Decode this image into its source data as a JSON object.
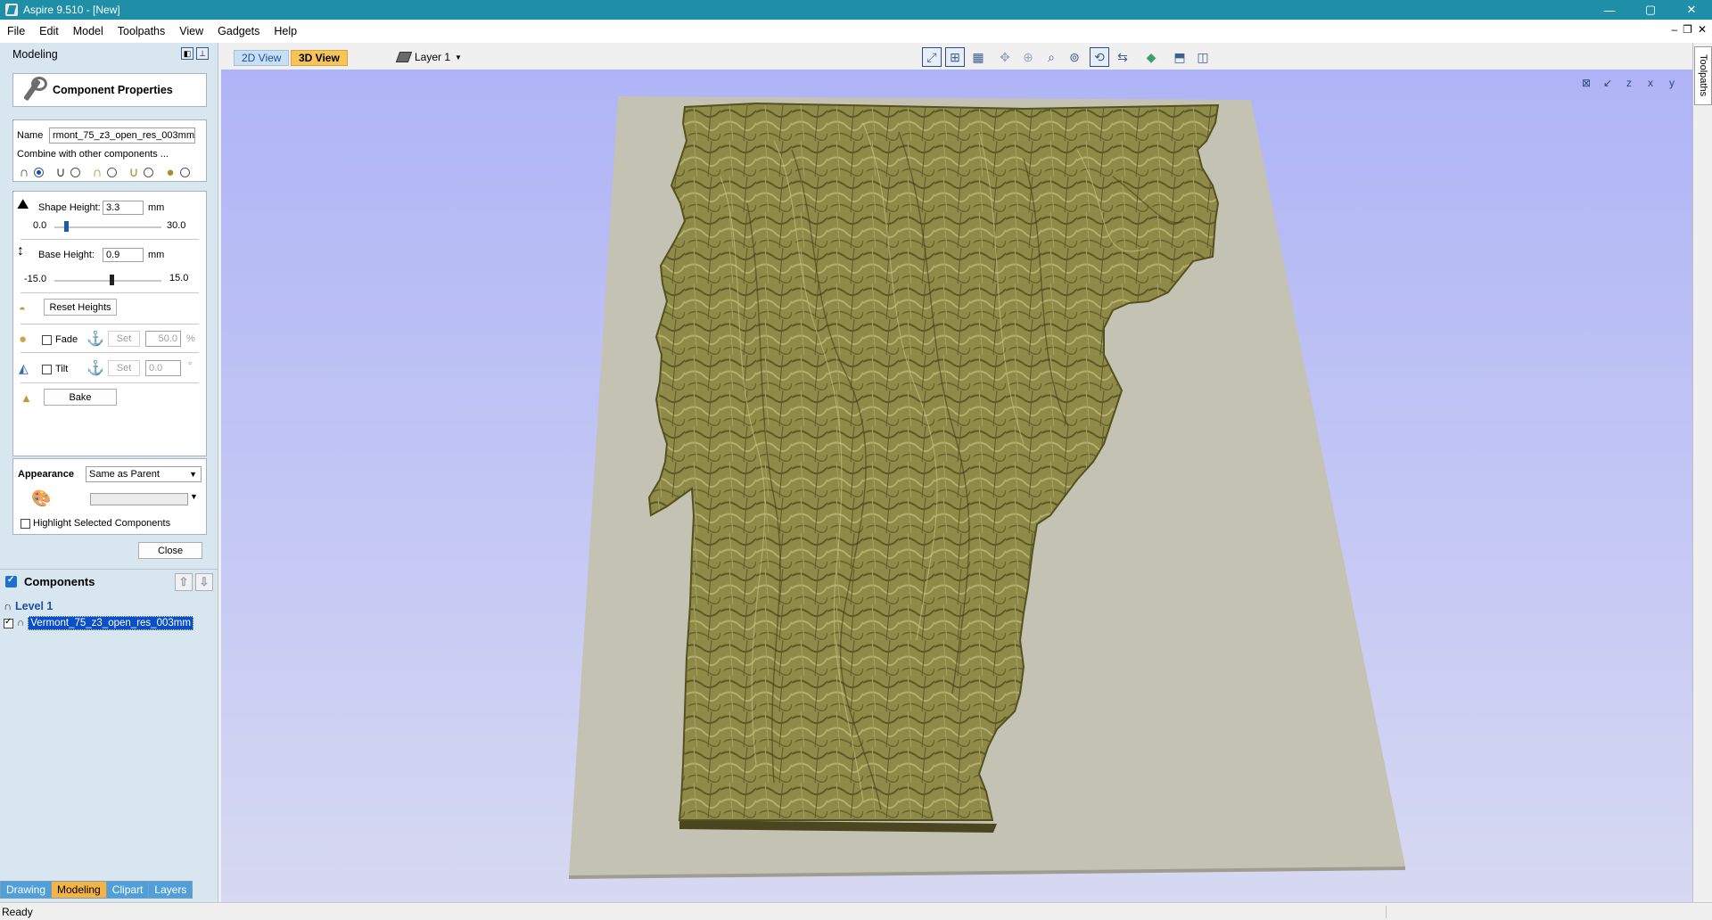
{
  "window": {
    "title": "Aspire 9.510 - [New]",
    "minimize": "—",
    "maximize": "▢",
    "close": "✕"
  },
  "menu": [
    "File",
    "Edit",
    "Model",
    "Toolpaths",
    "View",
    "Gadgets",
    "Help"
  ],
  "mdi": {
    "minimize": "–",
    "restore": "❐",
    "close": "✕"
  },
  "panel": {
    "title": "Modeling",
    "component_properties": {
      "header": "Component Properties",
      "name_label": "Name",
      "name_value": "rmont_75_z3_open_res_003mm",
      "combine_label": "Combine with other components ...",
      "combine_selected": "add",
      "shape_height": {
        "label": "Shape Height:",
        "value": "3.3",
        "unit": "mm",
        "min": "0.0",
        "max": "30.0",
        "fraction": 0.11
      },
      "base_height": {
        "label": "Base Height:",
        "value": "0.9",
        "unit": "mm",
        "min": "-15.0",
        "max": "15.0",
        "fraction": 0.53
      },
      "reset_heights": "Reset Heights",
      "fade": {
        "label": "Fade",
        "set": "Set",
        "value": "50.0",
        "unit": "%"
      },
      "tilt": {
        "label": "Tilt",
        "set": "Set",
        "value": "0.0",
        "unit": "°"
      },
      "bake": "Bake"
    },
    "appearance": {
      "label": "Appearance",
      "value": "Same as Parent",
      "highlight_label": "Highlight Selected Components"
    },
    "close": "Close",
    "components": {
      "header": "Components",
      "level": "Level 1",
      "item": "Vermont_75_z3_open_res_003mm"
    }
  },
  "bottom_tabs": [
    "Drawing",
    "Modeling",
    "Clipart",
    "Layers"
  ],
  "view_tabs": {
    "tab_2d": "2D View",
    "tab_3d": "3D View",
    "layer": "Layer 1"
  },
  "right_tab": "Toolpaths",
  "status": "Ready",
  "colors": {
    "title_bar": "#1e8fa6",
    "terrain": "#8e8a48",
    "base_plate": "#c3c2b3",
    "viewport_top": "#afb4f6"
  }
}
